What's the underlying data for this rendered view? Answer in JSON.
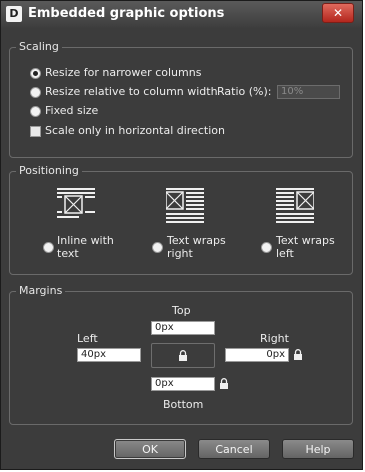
{
  "window": {
    "title": "Embedded graphic options",
    "app_icon": "D",
    "close_symbol": "✕"
  },
  "scaling": {
    "legend": "Scaling",
    "options": [
      {
        "label": "Resize for narrower columns",
        "checked": true
      },
      {
        "label": "Resize relative to column width",
        "checked": false
      },
      {
        "label": "Fixed size",
        "checked": false
      }
    ],
    "ratio_label": "Ratio (%):",
    "ratio_placeholder": "10%",
    "horizontal_only_label": "Scale only in horizontal direction"
  },
  "positioning": {
    "legend": "Positioning",
    "options": [
      {
        "line1": "Inline with",
        "line2": "text",
        "icon": "inline-layout-icon"
      },
      {
        "line1": "Text wraps",
        "line2": "right",
        "icon": "wrap-right-layout-icon"
      },
      {
        "line1": "Text wraps",
        "line2": "left",
        "icon": "wrap-left-layout-icon"
      }
    ]
  },
  "margins": {
    "legend": "Margins",
    "top_label": "Top",
    "top_value": "0px",
    "left_label": "Left",
    "left_value": "40px",
    "right_label": "Right",
    "right_value": "0px",
    "bottom_label": "Bottom",
    "bottom_value": "0px"
  },
  "buttons": {
    "ok": "OK",
    "cancel": "Cancel",
    "help": "Help"
  }
}
